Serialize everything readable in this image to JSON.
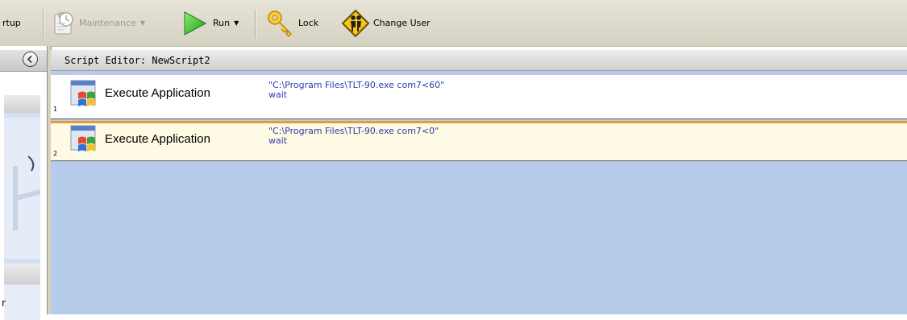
{
  "toolbar": {
    "startup_label": "rtup",
    "maintenance_label": "Maintenance",
    "run_label": "Run",
    "lock_label": "Lock",
    "change_user_label": "Change User"
  },
  "left_pane": {
    "clipped_letter": "r"
  },
  "editor": {
    "title": "Script Editor: NewScript2",
    "rows": [
      {
        "number": "1",
        "command": "Execute Application",
        "param1": "\"C:\\Program Files\\TLT-90.exe com7<60\"",
        "param2": "wait",
        "selected": false
      },
      {
        "number": "2",
        "command": "Execute Application",
        "param1": "\"C:\\Program Files\\TLT-90.exe com7<0\"",
        "param2": "wait",
        "selected": true
      }
    ]
  },
  "colors": {
    "toolbar_bg": "#d6d2c2",
    "editor_bg": "#b7cbea",
    "selected_row_bg": "#fefae3",
    "selection_border": "#ee9a2b",
    "param_text": "#2d3cae"
  },
  "icons": {
    "maintenance": "maintenance-icon",
    "run": "run-play-icon",
    "lock": "key-icon",
    "change_user": "change-user-sign-icon",
    "collapse": "collapse-left-icon",
    "command": "windows-application-icon"
  }
}
